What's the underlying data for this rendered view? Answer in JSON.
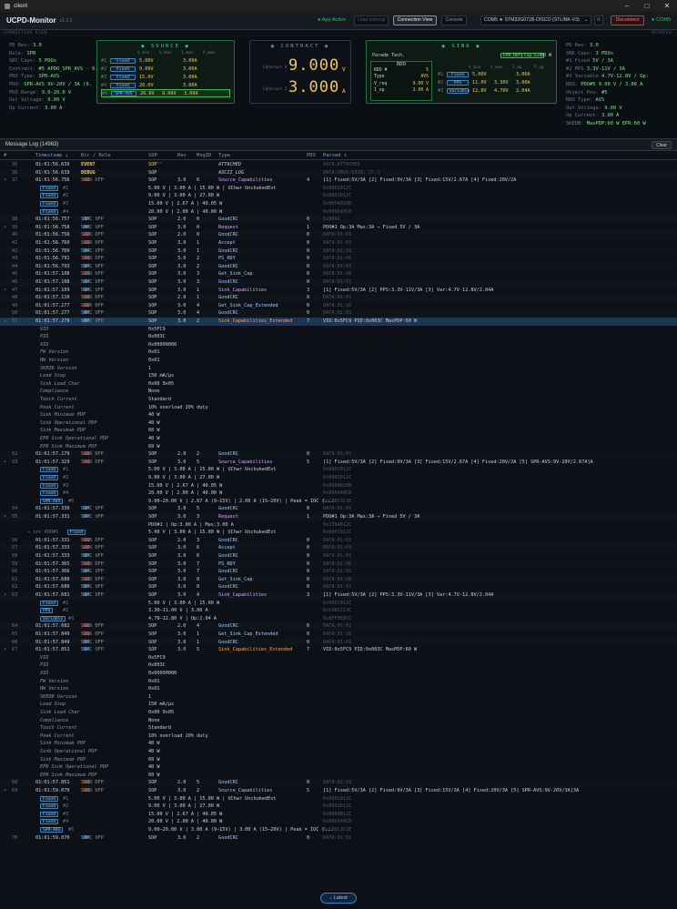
{
  "window": {
    "title": "client"
  },
  "app": {
    "name": "UCPD-Monitor",
    "version": "v1.2.3",
    "status": "App Active",
    "btn_load": "Load Internal",
    "btn_connection": "Connection View",
    "btn_console": "Console",
    "device": "COM5 ★ STM32G071B-DISCO (STLINK-V3)",
    "btn_disconnect": "Disconnect",
    "com_status": "COM5"
  },
  "connview": {
    "label": "CONNECTION VIEW",
    "refresh": "REFRESH"
  },
  "left_info": [
    {
      "k": "PD Rev:",
      "v": "3.0"
    },
    {
      "k": "Role:",
      "v": "SPR"
    },
    {
      "k": "SRC Caps:",
      "v": "5 PDOs"
    },
    {
      "k": "Contract:",
      "v": "#5 APDO_SPR_AVS · 9."
    },
    {
      "k": "PDO Type:",
      "v": "SPR-AVS"
    },
    {
      "k": "PDO:",
      "v": "SPR-AVS 9V-20V / 3A (9."
    },
    {
      "k": "PDO Range:",
      "v": "9.0-20.0 V"
    },
    {
      "k": "Out Voltage:",
      "v": "9.00 V"
    },
    {
      "k": "Op Current:",
      "v": "3.00 A"
    }
  ],
  "source": {
    "title": "SOURCE",
    "cols": [
      "V_min",
      "V_max",
      "I_max",
      "P_max"
    ],
    "rows": [
      {
        "idx": "#1",
        "type": "Fixed",
        "v1": "5.00V",
        "v2": "",
        "i": "3.00A",
        "p": ""
      },
      {
        "idx": "#2",
        "type": "Fixed",
        "v1": "9.00V",
        "v2": "",
        "i": "3.00A",
        "p": ""
      },
      {
        "idx": "#3",
        "type": "Fixed",
        "v1": "15.0V",
        "v2": "",
        "i": "3.00A",
        "p": ""
      },
      {
        "idx": "#4",
        "type": "Fixed",
        "v1": "20.0V",
        "v2": "",
        "i": "3.00A",
        "p": ""
      },
      {
        "idx": "#5",
        "type": "SPR-AVS",
        "v1": "20.0V",
        "v2": "9.00V",
        "i": "3.00A",
        "p": ""
      }
    ]
  },
  "contract": {
    "title": "CONTRACT",
    "voltage": "9.000",
    "v_unit": "V",
    "current": "3.000",
    "a_unit": "A",
    "lbl_v": "Contract V",
    "lbl_i": "Contract I"
  },
  "sink": {
    "title": "SINK",
    "vendor": "Parade Tech.",
    "epr": "EPR_RDY",
    "cap_ext": "Cap_Ext",
    "maxp": "60 W",
    "rdo_title": "RDO",
    "rdo": [
      {
        "k": "RDO #",
        "v": "5"
      },
      {
        "k": "Type",
        "v": "AVS"
      },
      {
        "k": "V_req",
        "v": "9.00 V"
      },
      {
        "k": "I_op",
        "v": "3.00 A"
      }
    ],
    "cols": [
      "V_min",
      "V_max",
      "I_op",
      "P_op"
    ],
    "rows": [
      {
        "idx": "#1",
        "type": "Fixed",
        "v1": "5.00V",
        "v2": "",
        "i": "3.00A",
        "p": ""
      },
      {
        "idx": "#2",
        "type": "PPS",
        "v1": "11.0V",
        "v2": "3.30V",
        "i": "3.00A",
        "p": ""
      },
      {
        "idx": "#3",
        "type": "Variable",
        "v1": "12.8V",
        "v2": "4.70V",
        "i": "2.04A",
        "p": ""
      }
    ]
  },
  "right_info": [
    {
      "k": "PD Rev:",
      "v": "3.0"
    },
    {
      "k": "SNK Caps:",
      "v": "3 PDOs"
    },
    {
      "k": "#1 Fixed",
      "v": "5V / 3A"
    },
    {
      "k": "#2 PPS",
      "v": "3.3V-11V / 3A"
    },
    {
      "k": "#3 Variable",
      "v": "4.7V-12.8V / Op:"
    },
    {
      "k": "RDO:",
      "v": "PDO#5 9.00 V / 3.00 A"
    },
    {
      "k": "Object Pos:",
      "v": "#5"
    },
    {
      "k": "RDO Type:",
      "v": "AVS"
    },
    {
      "k": "Out Voltage:",
      "v": "9.00 V"
    },
    {
      "k": "Op Current:",
      "v": "3.00 A"
    },
    {
      "k": "SKEDB:",
      "v": "MaxPDP:60 W EPR:60 W"
    }
  ],
  "log": {
    "title": "Message Log (14963)",
    "clear": "Clear",
    "latest": "↓ Latest",
    "columns": [
      "#",
      "Timestamp ↓",
      "Dir / Role",
      "SOP",
      "Rev",
      "MsgID",
      "Type",
      "PDO",
      "Parsed ↕"
    ]
  },
  "rows": [
    {
      "k": "msg",
      "n": "35",
      "ts": "01:01:56.639",
      "dir": "EVENT",
      "sop": "SOP''",
      "rev": "",
      "id": "",
      "ty": "ATTACHED",
      "tyc": "ev",
      "pdo": "",
      "par": "DATA:ATTACHED",
      "ph": 1
    },
    {
      "k": "msg",
      "n": "36",
      "ts": "01:01:56.639",
      "dir": "DEBUG",
      "sop": "SOP",
      "rev": "",
      "id": "",
      "ty": "ASCII_LOG",
      "tyc": "ev",
      "pdo": "",
      "par": "DATA:VBUS:5339, CC:1",
      "ph": 1
    },
    {
      "k": "msg",
      "n": "37",
      "ts": "01:01:56.756",
      "dir": "SRC",
      "role": "SNK DFP",
      "sop": "SOP",
      "rev": "3.0",
      "id": "0",
      "ty": "Source_Capabilities",
      "tyc": "dat",
      "pdo": "4",
      "par": "[1] Fixed:5V/3A [2] Fixed:9V/3A [3] Fixed:15V/2.67A [4] Fixed:20V/2A"
    },
    {
      "k": "pdo",
      "chip": "Fixed",
      "idx": "#1",
      "txt": "5.00 V | 3.00 A | 15.00 W | UChwr UnchukedExt",
      "hex": "0x0001912C"
    },
    {
      "k": "pdo",
      "chip": "Fixed",
      "idx": "#2",
      "txt": "9.00 V | 3.00 A | 27.00 W",
      "hex": "0x0002D12C"
    },
    {
      "k": "pdo",
      "chip": "Fixed",
      "idx": "#3",
      "txt": "15.00 V | 2.67 A | 40.05 W",
      "hex": "0x0004B10B"
    },
    {
      "k": "pdo",
      "chip": "Fixed",
      "idx": "#4",
      "txt": "20.00 V | 2.00 A | 40.00 W",
      "hex": "0x000640C8"
    },
    {
      "k": "msg",
      "n": "38",
      "ts": "01:01:56.757",
      "dir": "SNK",
      "role": "SRC UFP",
      "sop": "SOP",
      "rev": "2.0",
      "id": "0",
      "ty": "GoodCRC",
      "tyc": "ctl",
      "pdo": "0",
      "par": "0x0041",
      "ph": 1
    },
    {
      "k": "msg",
      "n": "39",
      "ts": "01:01:56.758",
      "dir": "SNK",
      "role": "SRC UFP",
      "sop": "SOP",
      "rev": "3.0",
      "id": "0",
      "ty": "Request",
      "tyc": "dat",
      "pdo": "1",
      "par": "PDO#1 Op:3A Max:3A → Fixed 5V / 3A"
    },
    {
      "k": "msg",
      "n": "40",
      "ts": "01:01:56.758",
      "dir": "SRC",
      "role": "SNK DFP",
      "sop": "SOP",
      "rev": "2.0",
      "id": "0",
      "ty": "GoodCRC",
      "tyc": "ctl",
      "pdo": "0",
      "par": "DATA:01:01",
      "ph": 1
    },
    {
      "k": "msg",
      "n": "41",
      "ts": "01:01:56.760",
      "dir": "SRC",
      "role": "SNK DFP",
      "sop": "SOP",
      "rev": "3.0",
      "id": "1",
      "ty": "Accept",
      "tyc": "ctl",
      "pdo": "0",
      "par": "DATA:01:03",
      "ph": 1
    },
    {
      "k": "msg",
      "n": "42",
      "ts": "01:01:56.760",
      "dir": "SNK",
      "role": "SRC UFP",
      "sop": "SOP",
      "rev": "3.0",
      "id": "1",
      "ty": "GoodCRC",
      "tyc": "ctl",
      "pdo": "0",
      "par": "DATA:01:01",
      "ph": 1
    },
    {
      "k": "msg",
      "n": "43",
      "ts": "01:01:56.792",
      "dir": "SRC",
      "role": "SNK DFP",
      "sop": "SOP",
      "rev": "3.0",
      "id": "2",
      "ty": "PS_RDY",
      "tyc": "ctl",
      "pdo": "0",
      "par": "DATA:01:06",
      "ph": 1
    },
    {
      "k": "msg",
      "n": "44",
      "ts": "01:01:56.793",
      "dir": "SNK",
      "role": "SRC UFP",
      "sop": "SOP",
      "rev": "3.0",
      "id": "2",
      "ty": "GoodCRC",
      "tyc": "ctl",
      "pdo": "0",
      "par": "DATA:01:01",
      "ph": 1
    },
    {
      "k": "msg",
      "n": "45",
      "ts": "01:01:57.108",
      "dir": "SRC",
      "role": "SNK DFP",
      "sop": "SOP",
      "rev": "3.0",
      "id": "3",
      "ty": "Get_Sink_Cap",
      "tyc": "ctl",
      "pdo": "0",
      "par": "DATA:01:08",
      "ph": 1
    },
    {
      "k": "msg",
      "n": "46",
      "ts": "01:01:57.108",
      "dir": "SNK",
      "role": "SRC UFP",
      "sop": "SOP",
      "rev": "3.0",
      "id": "3",
      "ty": "GoodCRC",
      "tyc": "ctl",
      "pdo": "0",
      "par": "DATA:01:01",
      "ph": 1
    },
    {
      "k": "msg",
      "n": "47",
      "ts": "01:01:57.109",
      "dir": "SNK",
      "role": "SRC UFP",
      "sop": "SOP",
      "rev": "3.0",
      "id": "1",
      "ty": "Sink_Capabilities",
      "tyc": "dat",
      "pdo": "3",
      "par": "[1] Fixed:5V/3A [2] PPS:3.3V-11V/3A [3] Var:4.7V-12.8V/2.04A"
    },
    {
      "k": "msg",
      "n": "48",
      "ts": "01:01:57.110",
      "dir": "SRC",
      "role": "SNK DFP",
      "sop": "SOP",
      "rev": "2.0",
      "id": "1",
      "ty": "GoodCRC",
      "tyc": "ctl",
      "pdo": "0",
      "par": "DATA:01:01",
      "ph": 1
    },
    {
      "k": "msg",
      "n": "49",
      "ts": "01:01:57.277",
      "dir": "SRC",
      "role": "SNK DFP",
      "sop": "SOP",
      "rev": "3.0",
      "id": "4",
      "ty": "Get_Sink_Cap_Extended",
      "tyc": "ctl",
      "pdo": "0",
      "par": "DATA:01:16",
      "ph": 1
    },
    {
      "k": "msg",
      "n": "50",
      "ts": "01:01:57.277",
      "dir": "SNK",
      "role": "SRC UFP",
      "sop": "SOP",
      "rev": "3.0",
      "id": "4",
      "ty": "GoodCRC",
      "tyc": "ctl",
      "pdo": "0",
      "par": "DATA:01:01",
      "ph": 1
    },
    {
      "k": "msg",
      "sel": 1,
      "n": "51",
      "ts": "01:01:57.279",
      "dir": "SNK",
      "role": "SRC UFP",
      "sop": "SOP",
      "rev": "3.0",
      "id": "2",
      "ty": "Sink_Capabilities_Extended",
      "tyc": "ext",
      "pdo": "7",
      "par": "VID:0x5FC9 PID:0x003C MaxPDP:60 W"
    },
    {
      "k": "det",
      "dk": "VID",
      "dv": "0x5FC9"
    },
    {
      "k": "det",
      "dk": "PID",
      "dv": "0x003C"
    },
    {
      "k": "det",
      "dk": "XID",
      "dv": "0x00000000"
    },
    {
      "k": "det",
      "dk": "FW Version",
      "dv": "0x01"
    },
    {
      "k": "det",
      "dk": "HW Version",
      "dv": "0x01"
    },
    {
      "k": "det",
      "dk": "SKEDB Version",
      "dv": "1"
    },
    {
      "k": "det",
      "dk": "Load Step",
      "dv": "150 mA/µs"
    },
    {
      "k": "det",
      "dk": "Sink Load Char",
      "dv": "0x00 0x05"
    },
    {
      "k": "det",
      "dk": "Compliance",
      "dv": "None"
    },
    {
      "k": "det",
      "dk": "Touch Current",
      "dv": "Standard"
    },
    {
      "k": "det",
      "dk": "Peak Current",
      "dv": "10% overload 20% duty"
    },
    {
      "k": "det",
      "dk": "Sink Minimum PDP",
      "dv": "40 W"
    },
    {
      "k": "det",
      "dk": "Sink Operational PDP",
      "dv": "40 W"
    },
    {
      "k": "det",
      "dk": "Sink Maximum PDP",
      "dv": "60 W"
    },
    {
      "k": "det",
      "dk": "EPR Sink Operational PDP",
      "dv": "40 W"
    },
    {
      "k": "det",
      "dk": "EPR Sink Maximum PDP",
      "dv": "60 W"
    },
    {
      "k": "msg",
      "n": "52",
      "ts": "01:01:57.279",
      "dir": "SRC",
      "role": "SNK DFP",
      "sop": "SOP",
      "rev": "2.0",
      "id": "2",
      "ty": "GoodCRC",
      "tyc": "ctl",
      "pdo": "0",
      "par": "DATA:01:01",
      "ph": 1
    },
    {
      "k": "msg",
      "n": "53",
      "ts": "01:01:57.329",
      "dir": "SRC",
      "role": "SNK DFP",
      "sop": "SOP",
      "rev": "3.0",
      "id": "5",
      "ty": "Source_Capabilities",
      "tyc": "dat",
      "pdo": "5",
      "par": "[1] Fixed:5V/3A [2] Fixed:9V/3A [3] Fixed:15V/2.67A [4] Fixed:20V/2A [5] SPR-AVS:9V-20V/2.67A]A"
    },
    {
      "k": "pdo",
      "chip": "Fixed",
      "idx": "#1",
      "txt": "5.00 V | 3.00 A | 15.00 W | UChwr UnchukedExt",
      "hex": "0x0001912C"
    },
    {
      "k": "pdo",
      "chip": "Fixed",
      "idx": "#2",
      "txt": "9.00 V | 3.00 A | 27.00 W",
      "hex": "0x0002D12C"
    },
    {
      "k": "pdo",
      "chip": "Fixed",
      "idx": "#3",
      "txt": "15.00 V | 2.67 A | 40.05 W",
      "hex": "0x0004B10B"
    },
    {
      "k": "pdo",
      "chip": "Fixed",
      "idx": "#4",
      "txt": "20.00 V | 2.00 A | 40.00 W",
      "hex": "0x000640C8"
    },
    {
      "k": "pdo",
      "chip": "SPR-AVS",
      "idx": "#5",
      "txt": "9.00–20.00 V | 2.67 A (9–15V) | 2.00 A (15–20V) | Peak = IOC (...",
      "hex": "0xC8DC2C1E"
    },
    {
      "k": "msg",
      "n": "54",
      "ts": "01:01:57.330",
      "dir": "SNK",
      "role": "SRC UFP",
      "sop": "SOP",
      "rev": "3.0",
      "id": "5",
      "ty": "GoodCRC",
      "tyc": "ctl",
      "pdo": "0",
      "par": "DATA:01:01",
      "ph": 1
    },
    {
      "k": "msg",
      "n": "55",
      "ts": "01:01:57.331",
      "dir": "SNK",
      "role": "SRC UFP",
      "sop": "SOP",
      "rev": "3.0",
      "id": "3",
      "ty": "Request",
      "tyc": "dat",
      "pdo": "1",
      "par": "PDO#1 Op:3A Max:3A → Fixed 5V / 3A"
    },
    {
      "k": "sub",
      "txt": "PDO#1 | Op:3.00 A | Max:3.00 A",
      "hex": "0x1304B12C"
    },
    {
      "k": "pdo",
      "chip": "Fixed",
      "idx": "→ src PDO#1",
      "txt": "5.00 V | 3.00 A | 15.00 W | UChwr UnchukedExt",
      "hex": "0x0001912C"
    },
    {
      "k": "msg",
      "n": "56",
      "ts": "01:01:57.331",
      "dir": "SRC",
      "role": "SNK DFP",
      "sop": "SOP",
      "rev": "2.0",
      "id": "3",
      "ty": "GoodCRC",
      "tyc": "ctl",
      "pdo": "0",
      "par": "DATA:01:01",
      "ph": 1
    },
    {
      "k": "msg",
      "n": "57",
      "ts": "01:01:57.333",
      "dir": "SRC",
      "role": "SNK DFP",
      "sop": "SOP",
      "rev": "3.0",
      "id": "6",
      "ty": "Accept",
      "tyc": "ctl",
      "pdo": "0",
      "par": "DATA:01:03",
      "ph": 1
    },
    {
      "k": "msg",
      "n": "58",
      "ts": "01:01:57.333",
      "dir": "SNK",
      "role": "SRC UFP",
      "sop": "SOP",
      "rev": "3.0",
      "id": "6",
      "ty": "GoodCRC",
      "tyc": "ctl",
      "pdo": "0",
      "par": "DATA:01:01",
      "ph": 1
    },
    {
      "k": "msg",
      "n": "59",
      "ts": "01:01:57.365",
      "dir": "SRC",
      "role": "SNK DFP",
      "sop": "SOP",
      "rev": "3.0",
      "id": "7",
      "ty": "PS_RDY",
      "tyc": "ctl",
      "pdo": "0",
      "par": "DATA:01:06",
      "ph": 1
    },
    {
      "k": "msg",
      "n": "60",
      "ts": "01:01:57.366",
      "dir": "SNK",
      "role": "SRC UFP",
      "sop": "SOP",
      "rev": "3.0",
      "id": "7",
      "ty": "GoodCRC",
      "tyc": "ctl",
      "pdo": "0",
      "par": "DATA:01:01",
      "ph": 1
    },
    {
      "k": "msg",
      "n": "61",
      "ts": "01:01:57.680",
      "dir": "SRC",
      "role": "SNK DFP",
      "sop": "SOP",
      "rev": "3.0",
      "id": "0",
      "ty": "Get_Sink_Cap",
      "tyc": "ctl",
      "pdo": "0",
      "par": "DATA:01:08",
      "ph": 1
    },
    {
      "k": "msg",
      "n": "62",
      "ts": "01:01:57.680",
      "dir": "SNK",
      "role": "SRC UFP",
      "sop": "SOP",
      "rev": "3.0",
      "id": "0",
      "ty": "GoodCRC",
      "tyc": "ctl",
      "pdo": "0",
      "par": "DATA:01:01",
      "ph": 1
    },
    {
      "k": "msg",
      "n": "63",
      "ts": "01:01:57.681",
      "dir": "SNK",
      "role": "SRC UFP",
      "sop": "SOP",
      "rev": "3.0",
      "id": "4",
      "ty": "Sink_Capabilities",
      "tyc": "dat",
      "pdo": "3",
      "par": "[1] Fixed:5V/3A [2] PPS:3.3V-11V/3A [3] Var:4.7V-12.8V/2.04A"
    },
    {
      "k": "pdo",
      "chip": "Fixed",
      "idx": "#1",
      "txt": "5.00 V | 3.00 A | 15.00 W",
      "hex": "0x0001912C"
    },
    {
      "k": "pdo",
      "chip": "PPS",
      "idx": "#2",
      "txt": "3.30–11.00 V | 3.00 A",
      "hex": "0xC0DC213C"
    },
    {
      "k": "pdo",
      "chip": "Variable",
      "idx": "#3",
      "txt": "4.70–12.80 V | Op:2.04 A",
      "hex": "0x8FF5E0CC"
    },
    {
      "k": "msg",
      "n": "64",
      "ts": "01:01:57.682",
      "dir": "SRC",
      "role": "SNK DFP",
      "sop": "SOP",
      "rev": "2.0",
      "id": "4",
      "ty": "GoodCRC",
      "tyc": "ctl",
      "pdo": "0",
      "par": "DATA:01:01",
      "ph": 1
    },
    {
      "k": "msg",
      "n": "65",
      "ts": "01:01:57.849",
      "dir": "SRC",
      "role": "SNK DFP",
      "sop": "SOP",
      "rev": "3.0",
      "id": "1",
      "ty": "Get_Sink_Cap_Extended",
      "tyc": "ctl",
      "pdo": "0",
      "par": "DATA:01:16",
      "ph": 1
    },
    {
      "k": "msg",
      "n": "66",
      "ts": "01:01:57.849",
      "dir": "SNK",
      "role": "SRC UFP",
      "sop": "SOP",
      "rev": "3.0",
      "id": "1",
      "ty": "GoodCRC",
      "tyc": "ctl",
      "pdo": "0",
      "par": "DATA:01:01",
      "ph": 1
    },
    {
      "k": "msg",
      "n": "67",
      "ts": "01:01:57.851",
      "dir": "SNK",
      "role": "SRC UFP",
      "sop": "SOP",
      "rev": "3.0",
      "id": "5",
      "ty": "Sink_Capabilities_Extended",
      "tyc": "ext",
      "pdo": "7",
      "par": "VID:0x5FC9 PID:0x003C MaxPDP:60 W"
    },
    {
      "k": "det",
      "dk": "VID",
      "dv": "0x5FC9"
    },
    {
      "k": "det",
      "dk": "PID",
      "dv": "0x003C"
    },
    {
      "k": "det",
      "dk": "XID",
      "dv": "0x00000000"
    },
    {
      "k": "det",
      "dk": "FW Version",
      "dv": "0x01"
    },
    {
      "k": "det",
      "dk": "HW Version",
      "dv": "0x01"
    },
    {
      "k": "det",
      "dk": "SKEDB Version",
      "dv": "1"
    },
    {
      "k": "det",
      "dk": "Load Step",
      "dv": "150 mA/µs"
    },
    {
      "k": "det",
      "dk": "Sink Load Char",
      "dv": "0x00 0x05"
    },
    {
      "k": "det",
      "dk": "Compliance",
      "dv": "None"
    },
    {
      "k": "det",
      "dk": "Touch Current",
      "dv": "Standard"
    },
    {
      "k": "det",
      "dk": "Peak Current",
      "dv": "10% overload 20% duty"
    },
    {
      "k": "det",
      "dk": "Sink Minimum PDP",
      "dv": "40 W"
    },
    {
      "k": "det",
      "dk": "Sink Operational PDP",
      "dv": "40 W"
    },
    {
      "k": "det",
      "dk": "Sink Maximum PDP",
      "dv": "60 W"
    },
    {
      "k": "det",
      "dk": "EPR Sink Operational PDP",
      "dv": "40 W"
    },
    {
      "k": "det",
      "dk": "EPR Sink Maximum PDP",
      "dv": "60 W"
    },
    {
      "k": "msg",
      "n": "68",
      "ts": "01:01:57.851",
      "dir": "SRC",
      "role": "SNK DFP",
      "sop": "SOP",
      "rev": "2.0",
      "id": "5",
      "ty": "GoodCRC",
      "tyc": "ctl",
      "pdo": "0",
      "par": "DATA:01:01",
      "ph": 1
    },
    {
      "k": "msg",
      "n": "69",
      "ts": "01:01:59.070",
      "dir": "SRC",
      "role": "SNK DFP",
      "sop": "SOP",
      "rev": "3.0",
      "id": "2",
      "ty": "Source_Capabilities",
      "tyc": "dat",
      "pdo": "5",
      "par": "[1] Fixed:5V/3A [2] Fixed:9V/3A [3] Fixed:15V/3A [4] Fixed:20V/3A [5] SPR-AVS:9V-20V/3A]3A"
    },
    {
      "k": "pdo",
      "chip": "Fixed",
      "idx": "#1",
      "txt": "5.00 V | 3.00 A | 15.00 W | UChwr UnchukedExt",
      "hex": "0x0001912C"
    },
    {
      "k": "pdo",
      "chip": "Fixed",
      "idx": "#2",
      "txt": "9.00 V | 3.00 A | 27.00 W",
      "hex": "0x0002D12C"
    },
    {
      "k": "pdo",
      "chip": "Fixed",
      "idx": "#3",
      "txt": "15.00 V | 2.67 A | 40.05 W",
      "hex": "0x0004B12C"
    },
    {
      "k": "pdo",
      "chip": "Fixed",
      "idx": "#4",
      "txt": "20.00 V | 2.00 A | 40.00 W",
      "hex": "0x000640C8"
    },
    {
      "k": "pdo",
      "chip": "SPR-AVS",
      "idx": "#5",
      "txt": "9.00–20.00 V | 3.00 A (9–15V) | 3.00 A (15–20V) | Peak = IOC (...",
      "hex": "0xC8DC2C1E"
    },
    {
      "k": "msg",
      "n": "70",
      "ts": "01:01:59.070",
      "dir": "SNK",
      "role": "SRC UFP",
      "sop": "SOP",
      "rev": "3.0",
      "id": "2",
      "ty": "GoodCRC",
      "tyc": "ctl",
      "pdo": "0",
      "par": "DATA:01:01",
      "ph": 1
    }
  ]
}
